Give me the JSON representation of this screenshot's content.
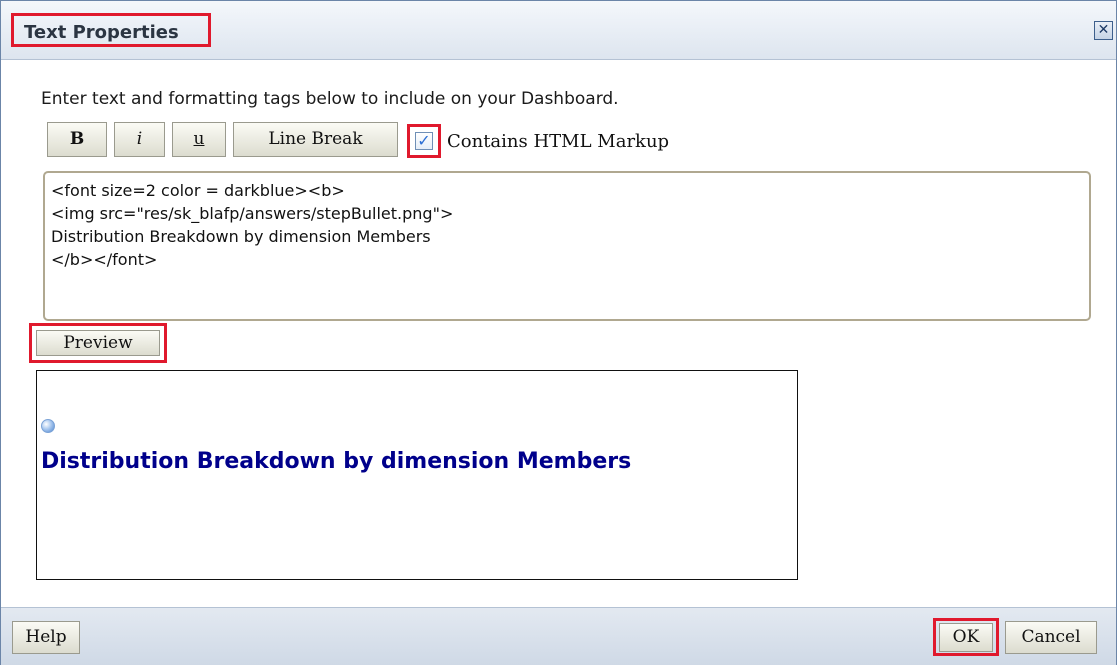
{
  "dialog": {
    "title": "Text Properties",
    "close_icon_glyph": "✕"
  },
  "instructions": "Enter text and formatting tags below to include on your Dashboard.",
  "toolbar": {
    "bold_label": "B",
    "italic_label": "i",
    "underline_label": "u",
    "line_break_label": "Line Break",
    "html_markup_checkbox": {
      "label": "Contains HTML Markup",
      "checked": true,
      "check_glyph": "✓"
    }
  },
  "editor": {
    "lines": [
      "<font size=2 color = darkblue><b>",
      "<img src=\"res/sk_blafp/answers/stepBullet.png\">",
      "Distribution Breakdown by dimension Members",
      "</b></font>"
    ]
  },
  "preview": {
    "button_label": "Preview",
    "bullet_icon": "step-bullet-icon",
    "text": "Distribution Breakdown by dimension Members",
    "text_color": "#00008b"
  },
  "footer": {
    "help_label": "Help",
    "ok_label": "OK",
    "cancel_label": "Cancel"
  },
  "colors": {
    "highlight": "#e0192d",
    "titlebar": "#dde5ef"
  }
}
